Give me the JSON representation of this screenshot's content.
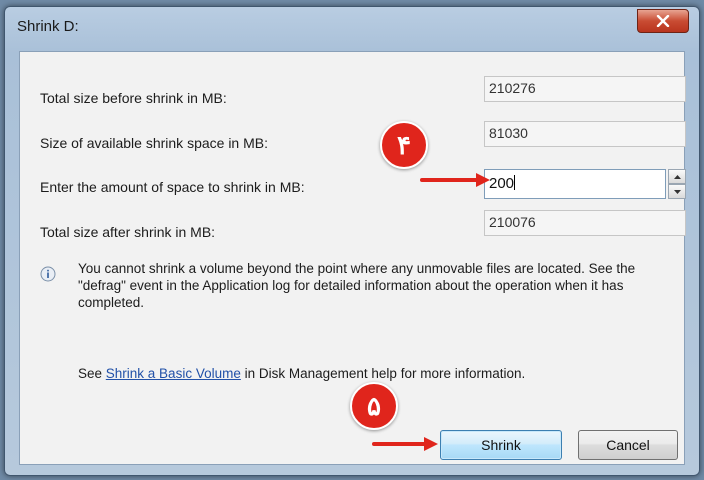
{
  "window": {
    "title": "Shrink D:"
  },
  "rows": [
    {
      "label": "Total size before shrink in MB:",
      "value": "210276"
    },
    {
      "label": "Size of available shrink space in MB:",
      "value": "81030"
    },
    {
      "label": "Enter the amount of space to shrink in MB:",
      "value": "200"
    },
    {
      "label": "Total size after shrink in MB:",
      "value": "210076"
    }
  ],
  "info": {
    "icon": "info-icon",
    "text": "You cannot shrink a volume beyond the point where any unmovable files are located. See the \"defrag\" event in the Application log for detailed information about the operation when it has completed."
  },
  "help": {
    "prefix": "See ",
    "link": "Shrink a Basic Volume",
    "suffix": " in Disk Management help for more information."
  },
  "buttons": {
    "shrink": "Shrink",
    "cancel": "Cancel"
  },
  "annotations": [
    {
      "number": "۴",
      "color": "#e0251c"
    },
    {
      "number": "۵",
      "color": "#e0251c"
    }
  ]
}
